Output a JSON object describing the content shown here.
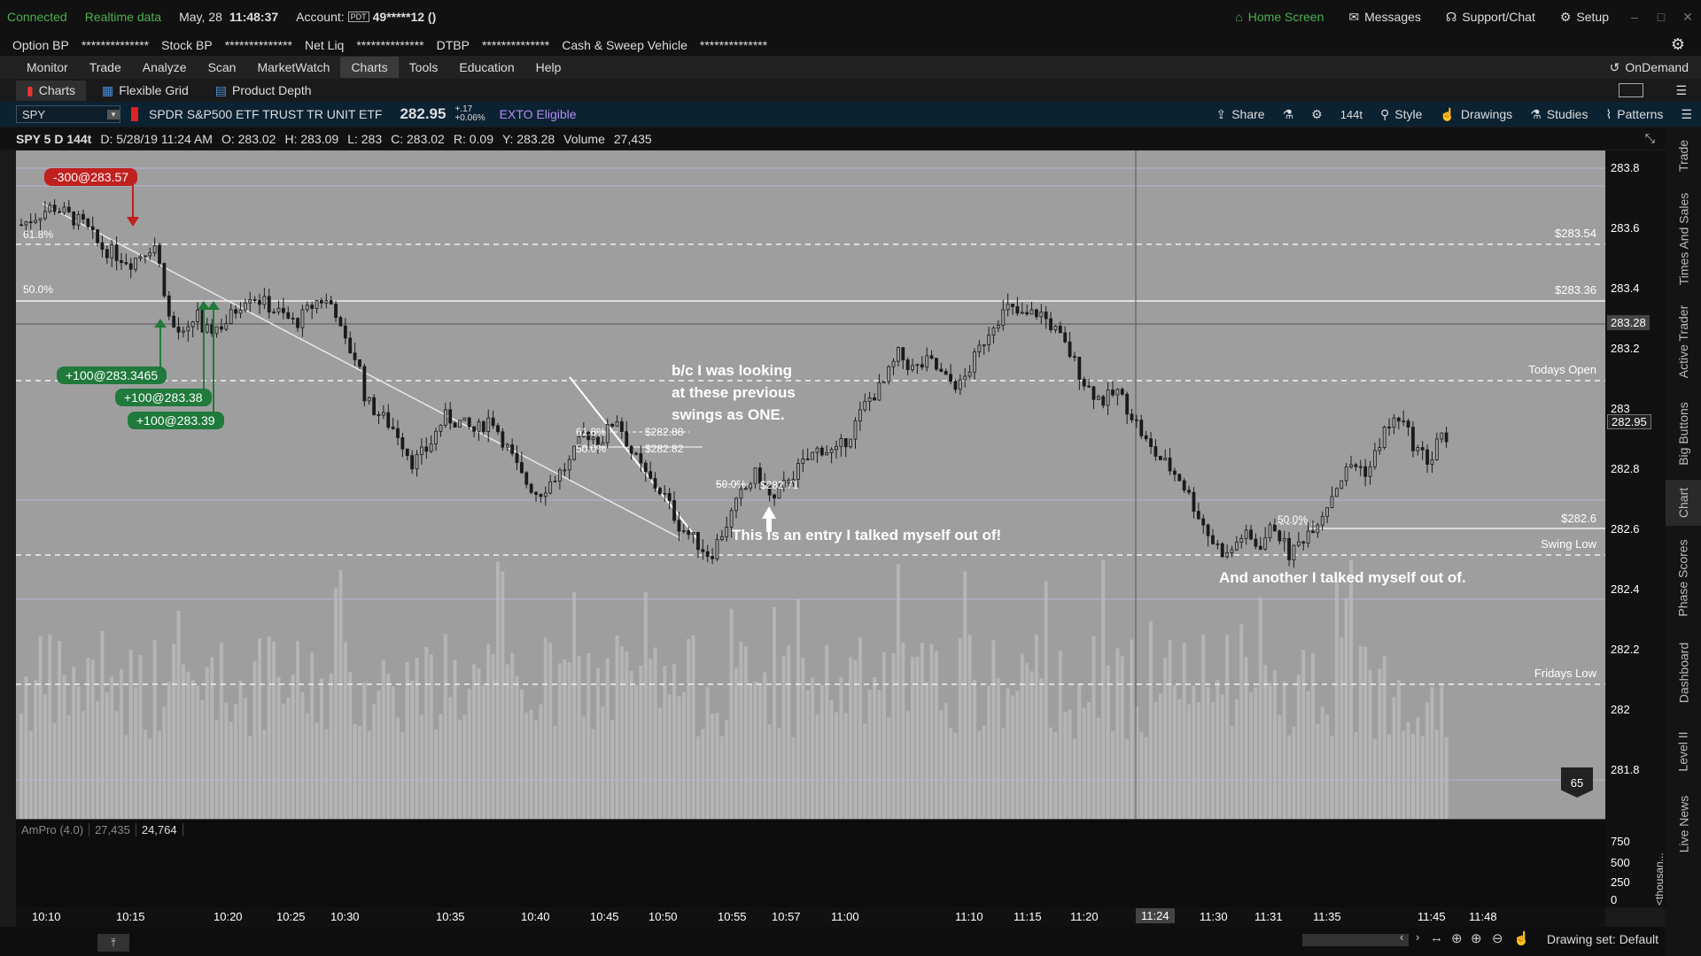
{
  "status": {
    "connected": "Connected",
    "realtime": "Realtime data",
    "date": "May, 28",
    "time": "11:48:37",
    "account_label": "Account:",
    "account_badge": "PDT",
    "account_value": "49*****12 ()",
    "home": "Home Screen",
    "messages": "Messages",
    "support": "Support/Chat",
    "setup": "Setup"
  },
  "balances": {
    "option_bp_label": "Option BP",
    "option_bp": "**************",
    "stock_bp_label": "Stock BP",
    "stock_bp": "**************",
    "net_liq_label": "Net Liq",
    "net_liq": "**************",
    "dtbp_label": "DTBP",
    "dtbp": "**************",
    "sweep_label": "Cash & Sweep Vehicle",
    "sweep": "**************"
  },
  "menu": [
    "Monitor",
    "Trade",
    "Analyze",
    "Scan",
    "MarketWatch",
    "Charts",
    "Tools",
    "Education",
    "Help"
  ],
  "ondemand": "OnDemand",
  "subtabs": [
    "Charts",
    "Flexible Grid",
    "Product Depth"
  ],
  "toolbar": {
    "symbol": "SPY",
    "description": "SPDR S&P500 ETF TRUST TR UNIT ETF",
    "price": "282.95",
    "change": "+.17",
    "change_pct": "+0.06%",
    "exto": "EXTO Eligible",
    "share": "Share",
    "aggregation": "144t",
    "style": "Style",
    "drawings": "Drawings",
    "studies": "Studies",
    "patterns": "Patterns"
  },
  "infobar": {
    "symbol": "SPY 5 D 144t",
    "date": "D: 5/28/19 11:24 AM",
    "open": "O: 283.02",
    "high": "H: 283.09",
    "low": "L: 283",
    "close": "C: 283.02",
    "range": "R: 0.09",
    "y": "Y: 283.28",
    "volume_label": "Volume",
    "volume": "27,435"
  },
  "orders": {
    "sell": "-300@283.57",
    "buy1": "+100@283.3465",
    "buy2": "+100@283.38",
    "buy3": "+100@283.39"
  },
  "annotations": {
    "note1": [
      "b/c I was looking",
      "at these previous",
      "swings as ONE."
    ],
    "note2": "This is an entry I talked myself out of!",
    "note3": "And another I talked myself out of."
  },
  "level_labels": {
    "p1": "$283.54",
    "p2": "$283.36",
    "open": "Todays Open",
    "p3": "$282.6",
    "swing": "Swing Low",
    "fri": "Fridays Low"
  },
  "fib_labels": {
    "f1": "61.8%",
    "f2": "50.0%",
    "f3": "61.8%",
    "f4": "50.0%",
    "f5": "$282.88",
    "f6": "$282.82",
    "f7": "50.0%",
    "f8": "$282.71",
    "f9": "50.0%"
  },
  "yaxis": {
    "ticks": [
      "283.8",
      "283.6",
      "283.4",
      "283.2",
      "283",
      "282.8",
      "282.6",
      "282.4",
      "282.2",
      "282",
      "281.8"
    ],
    "current_y": "283.28",
    "last_price": "282.95",
    "badge": "65"
  },
  "lower": {
    "study": "AmPro (4.0)",
    "v1": "27,435",
    "v2": "24,764",
    "ticks": [
      "750",
      "500",
      "250",
      "0"
    ],
    "unit": "<thousan..."
  },
  "xaxis": {
    "ticks": [
      "10:10",
      "10:15",
      "10:20",
      "10:25",
      "10:30",
      "10:35",
      "10:40",
      "10:45",
      "10:50",
      "10:55",
      "10:57",
      "11:00",
      "11:10",
      "11:15",
      "11:20",
      "11:24",
      "11:30",
      "11:31",
      "11:35",
      "11:45",
      "11:48"
    ]
  },
  "side_tabs": [
    "Trade",
    "Times And Sales",
    "Active Trader",
    "Big Buttons",
    "Chart",
    "Phase Scores",
    "Dashboard",
    "Level II",
    "Live News"
  ],
  "drawing_set": "Drawing set: Default",
  "colors": {
    "chart_bg": "#9e9e9e",
    "candle": "#1a1a1a",
    "buy_tag": "#1f7a3b",
    "sell_tag": "#c0201e",
    "toolbar_bg": "#0b2233",
    "exto": "#b48cf0"
  },
  "chart_data": {
    "type": "candlestick",
    "symbol": "SPY",
    "ylim": [
      281.7,
      283.86
    ],
    "price_path": [
      [
        0.0,
        283.62
      ],
      [
        0.02,
        283.68
      ],
      [
        0.04,
        283.62
      ],
      [
        0.05,
        283.55
      ],
      [
        0.07,
        283.5
      ],
      [
        0.085,
        283.56
      ],
      [
        0.09,
        283.45
      ],
      [
        0.095,
        283.3
      ],
      [
        0.105,
        283.25
      ],
      [
        0.115,
        283.38
      ],
      [
        0.11,
        283.22
      ],
      [
        0.12,
        283.28
      ],
      [
        0.13,
        283.3
      ],
      [
        0.145,
        283.4
      ],
      [
        0.16,
        283.35
      ],
      [
        0.175,
        283.3
      ],
      [
        0.19,
        283.38
      ],
      [
        0.2,
        283.36
      ],
      [
        0.205,
        283.25
      ],
      [
        0.215,
        283.18
      ],
      [
        0.22,
        283.05
      ],
      [
        0.24,
        282.95
      ],
      [
        0.25,
        282.85
      ],
      [
        0.26,
        282.9
      ],
      [
        0.27,
        283.0
      ],
      [
        0.28,
        282.98
      ],
      [
        0.29,
        282.95
      ],
      [
        0.3,
        283.0
      ],
      [
        0.31,
        282.9
      ],
      [
        0.32,
        282.8
      ],
      [
        0.33,
        282.75
      ],
      [
        0.34,
        282.8
      ],
      [
        0.35,
        282.85
      ],
      [
        0.36,
        282.95
      ],
      [
        0.37,
        282.92
      ],
      [
        0.38,
        283.0
      ],
      [
        0.39,
        282.88
      ],
      [
        0.4,
        282.8
      ],
      [
        0.41,
        282.75
      ],
      [
        0.415,
        282.7
      ],
      [
        0.42,
        282.65
      ],
      [
        0.43,
        282.6
      ],
      [
        0.44,
        282.55
      ],
      [
        0.45,
        282.65
      ],
      [
        0.46,
        282.75
      ],
      [
        0.47,
        282.82
      ],
      [
        0.48,
        282.72
      ],
      [
        0.49,
        282.8
      ],
      [
        0.5,
        282.85
      ],
      [
        0.51,
        282.9
      ],
      [
        0.52,
        282.88
      ],
      [
        0.53,
        282.95
      ],
      [
        0.54,
        283.05
      ],
      [
        0.55,
        283.1
      ],
      [
        0.56,
        283.2
      ],
      [
        0.57,
        283.15
      ],
      [
        0.58,
        283.18
      ],
      [
        0.59,
        283.12
      ],
      [
        0.6,
        283.1
      ],
      [
        0.61,
        283.2
      ],
      [
        0.62,
        283.3
      ],
      [
        0.63,
        283.35
      ],
      [
        0.64,
        283.32
      ],
      [
        0.65,
        283.34
      ],
      [
        0.66,
        283.28
      ],
      [
        0.67,
        283.2
      ],
      [
        0.68,
        283.1
      ],
      [
        0.69,
        283.05
      ],
      [
        0.7,
        283.08
      ],
      [
        0.71,
        283.0
      ],
      [
        0.72,
        282.9
      ],
      [
        0.73,
        282.85
      ],
      [
        0.74,
        282.8
      ],
      [
        0.75,
        282.7
      ],
      [
        0.76,
        282.6
      ],
      [
        0.77,
        282.55
      ],
      [
        0.78,
        282.62
      ],
      [
        0.79,
        282.58
      ],
      [
        0.8,
        282.65
      ],
      [
        0.81,
        282.55
      ],
      [
        0.82,
        282.62
      ],
      [
        0.83,
        282.68
      ],
      [
        0.84,
        282.78
      ],
      [
        0.85,
        282.85
      ],
      [
        0.86,
        282.82
      ],
      [
        0.87,
        282.95
      ],
      [
        0.88,
        283.0
      ],
      [
        0.89,
        282.9
      ],
      [
        0.9,
        282.85
      ],
      [
        0.905,
        282.95
      ],
      [
        0.91,
        282.9
      ]
    ]
  }
}
